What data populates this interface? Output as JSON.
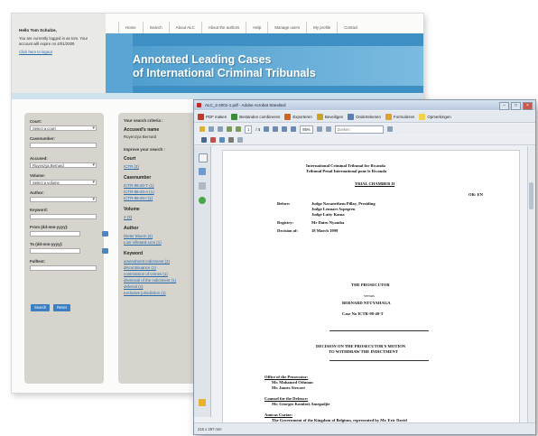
{
  "site": {
    "login": {
      "greeting": "Hello Tom Schulze,",
      "status": "You are currently logged in as tom. Your account will expire on 4/01/2009",
      "logout": "Click here to logout"
    },
    "nav": [
      "Home",
      "Search",
      "About ALC",
      "About the authors",
      "Help",
      "Manage users",
      "My profile",
      "Contact"
    ],
    "banner": {
      "line1": "Annotated Leading Cases",
      "line2": "of International Criminal Tribunals"
    },
    "search_form": {
      "court_label": "Court:",
      "court_value": "Select a court",
      "casenumber_label": "Casenumber:",
      "accused_label": "Accused:",
      "accused_value": "Ruyenzya Bernard",
      "volume_label": "Volume:",
      "volume_value": "Select a volume",
      "author_label": "Author:",
      "keyword_label": "Keyword:",
      "from_label": "From (dd-mm-yyyy):",
      "to_label": "To (dd-mm-yyyy):",
      "fulltext_label": "Fulltext:",
      "search_button": "Search",
      "reset_button": "Reset"
    },
    "results": {
      "criteria_title": "Your search criteria :",
      "accused_name_label": "Accused's name",
      "accused_name_value": "Ruyenzya Bernard",
      "refine_title": "Improve your search :",
      "court_head": "Court",
      "court_items": [
        "ICTR (3)"
      ],
      "casenumber_head": "Casenumber",
      "casenumber_items": [
        "ICTR-98-40-T (1)",
        "ICTR-98-40-A (1)",
        "ICTR-98-40-I (1)"
      ],
      "volume_head": "Volume",
      "volume_items": [
        "2 (3)"
      ],
      "author_head": "Author",
      "author_items": [
        "Dieter Bloem (2)",
        "Loni Villetard-Linn (1)"
      ],
      "keyword_head": "Keyword",
      "keyword_items": [
        "amendment indictment (2)",
        "discontinuance (1)",
        "commission of crimes (1)",
        "dismissal of the indictment (1)",
        "deferral (1)",
        "exclusive jurisdiction (1)"
      ]
    }
  },
  "pdf_viewer": {
    "title": "ALC_2-2001-1.pdf - Adobe Acrobat Standard",
    "toolbar1": [
      "PDF maken",
      "Bestanden combineren",
      "Exporteren",
      "Beveiligen",
      "Ondertekenen",
      "Formulieren",
      "Opmerkingen"
    ],
    "page_number": "1",
    "page_total": "/ 4",
    "zoom": "85%",
    "find_placeholder": "Zoeken",
    "status": "215 x 297 mm",
    "document": {
      "tribunal_en": "International Criminal Tribunal for Rwanda",
      "tribunal_fr": "Tribunal Penal International pour le Rwanda",
      "chamber": "TRIAL CHAMBER II",
      "or_code": "OR: EN",
      "before_label": "Before:",
      "judges": [
        "Judge Navanethem Pillay, Presiding",
        "Judge Lennart Aspegren",
        "Judge Laity Kama"
      ],
      "registry_label": "Registry:",
      "registry_value": "Mr Dairo Nyamba",
      "decision_label": "Decision of:",
      "decision_value": "18 March 1999",
      "prosecutor": "THE PROSECUTOR",
      "versus": "versus",
      "accused": "BERNARD NTUYAHAGA",
      "case_no": "Case No ICTR-98-40-T",
      "motion_line1": "DECISION ON THE PROSECUTOR'S MOTION",
      "motion_line2": "TO WITHDRAW THE INDICTMENT",
      "office_prosecutor_label": "Office of the Prosecutor:",
      "prosecutors": [
        "Mr. Mohamed Othman",
        "Mr. James Stewart"
      ],
      "counsel_label": "Counsel for the Defence:",
      "counsel": [
        "Mr. Georges Komlavi Amegadjie"
      ],
      "amicus_label": "Amicus Curiae:",
      "amicus": [
        "The Government of the Kingdom of Belgium, represented by Mr. Eric David"
      ]
    }
  },
  "colors": {
    "banner_blue": "#3d8fc4",
    "link_blue": "#2a6aa8",
    "panel_grey": "#d7d4cd",
    "button_blue": "#3d7fc1"
  }
}
